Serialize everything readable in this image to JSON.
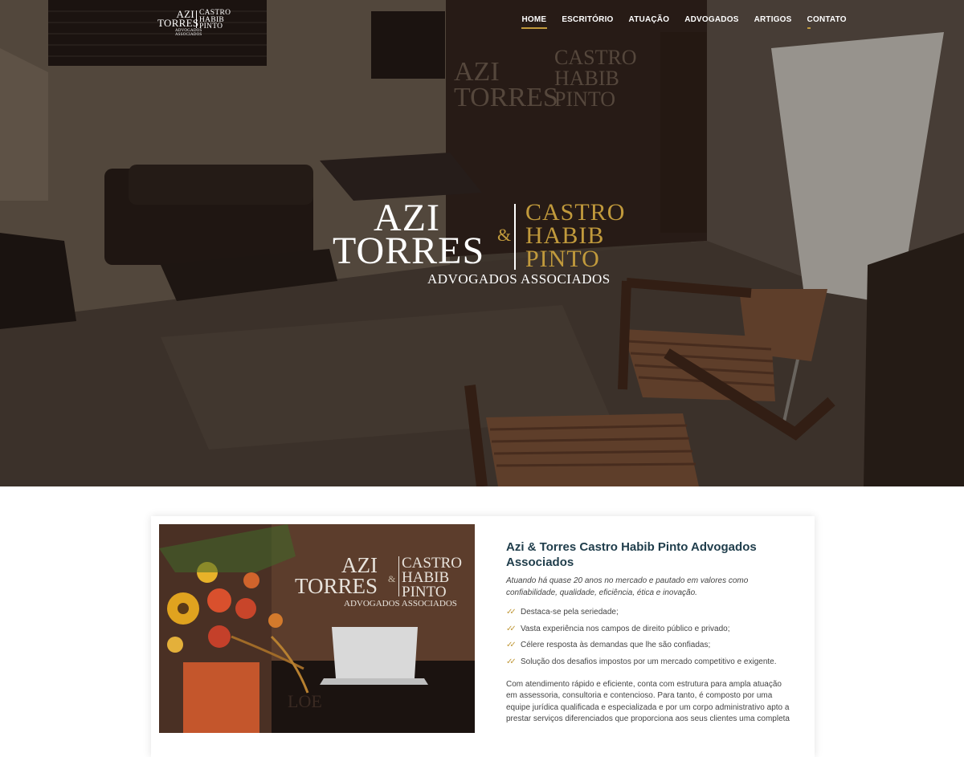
{
  "brand": {
    "left_line1": "AZI",
    "left_line2": "TORRES",
    "right_line1": "CASTRO",
    "right_line2": "HABIB",
    "right_line3": "PINTO",
    "bottom": "ADVOGADOS ASSOCIADOS"
  },
  "nav": {
    "items": [
      {
        "label": "HOME",
        "active": true
      },
      {
        "label": "ESCRITÓRIO"
      },
      {
        "label": "ATUAÇÃO"
      },
      {
        "label": "ADVOGADOS"
      },
      {
        "label": "ARTIGOS"
      },
      {
        "label": "CONTATO"
      }
    ]
  },
  "hero": {
    "logo_left_line1": "AZI",
    "logo_left_line2": "TORRES",
    "logo_amp": "&",
    "logo_right_line1": "CASTRO",
    "logo_right_line2": "HABIB",
    "logo_right_line3": "PINTO",
    "logo_bottom": "ADVOGADOS ASSOCIADOS"
  },
  "photo_sign": {
    "left_line1": "AZI",
    "left_line2": "TORRES",
    "amp": "&",
    "right_line1": "CASTRO",
    "right_line2": "HABIB",
    "right_line3": "PINTO",
    "bottom": "ADVOGADOS ASSOCIADOS"
  },
  "about": {
    "title": "Azi & Torres Castro Habib Pinto Advogados Associados",
    "lead": "Atuando há quase 20 anos no mercado e pautado em valores como confiabilidade, qualidade, eficiência, ética e inovação.",
    "bullets": [
      "Destaca-se pela seriedade;",
      "Vasta experiência nos campos de direito público e privado;",
      "Célere resposta às demandas que lhe são confiadas;",
      "Solução dos desafios impostos por um mercado competitivo e exigente."
    ],
    "body": "Com atendimento rápido e eficiente, conta com estrutura para ampla atuação em assessoria, consultoria e contencioso. Para tanto, é composto por uma equipe jurídica qualificada e especializada e por um corpo administrativo apto a prestar serviços diferenciados que proporciona aos seus clientes uma completa"
  },
  "colors": {
    "accent_gold": "#c19a3c",
    "heading": "#1f3d4b",
    "text": "#444444"
  }
}
